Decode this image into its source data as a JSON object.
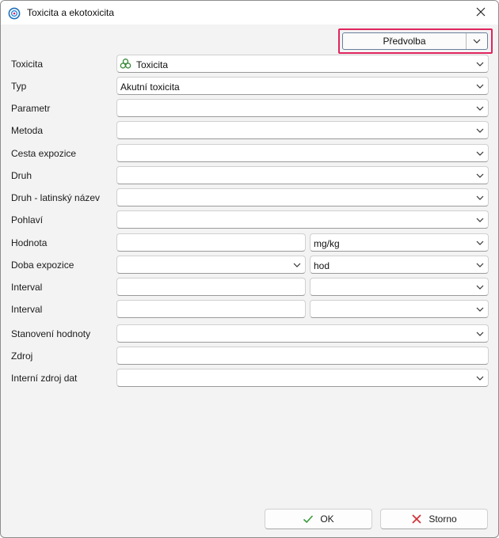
{
  "window": {
    "title": "Toxicita a ekotoxicita",
    "app_icon": "target-icon",
    "close_icon": "close-icon"
  },
  "preset": {
    "label": "Předvolba"
  },
  "form": {
    "toxicity_type": {
      "label": "Toxicita",
      "value": "Toxicita",
      "icon": "biohazard-icon",
      "icon_color": "#3a8a3a"
    },
    "type": {
      "label": "Typ",
      "value": "Akutní toxicita"
    },
    "parameter": {
      "label": "Parametr",
      "value": ""
    },
    "method": {
      "label": "Metoda",
      "value": ""
    },
    "exposure_route": {
      "label": "Cesta expozice",
      "value": ""
    },
    "species": {
      "label": "Druh",
      "value": ""
    },
    "species_latin": {
      "label": "Druh - latinský název",
      "value": ""
    },
    "sex": {
      "label": "Pohlaví",
      "value": ""
    },
    "value": {
      "label": "Hodnota",
      "value": "",
      "unit": "mg/kg"
    },
    "exposure_duration": {
      "label": "Doba expozice",
      "value": "",
      "unit": "hod"
    },
    "interval_1": {
      "label": "Interval",
      "value": "",
      "unit": ""
    },
    "interval_2": {
      "label": "Interval",
      "value": "",
      "unit": ""
    },
    "value_determination": {
      "label": "Stanovení hodnoty",
      "value": ""
    },
    "source": {
      "label": "Zdroj",
      "value": ""
    },
    "internal_source": {
      "label": "Interní zdroj dat",
      "value": ""
    }
  },
  "buttons": {
    "ok": {
      "label": "OK",
      "icon": "checkmark-icon",
      "icon_color": "#3a9a3a"
    },
    "cancel": {
      "label": "Storno",
      "icon": "cross-icon",
      "icon_color": "#d13438"
    }
  },
  "colors": {
    "highlight": "#e0245e",
    "window_bg": "#f3f3f3"
  }
}
